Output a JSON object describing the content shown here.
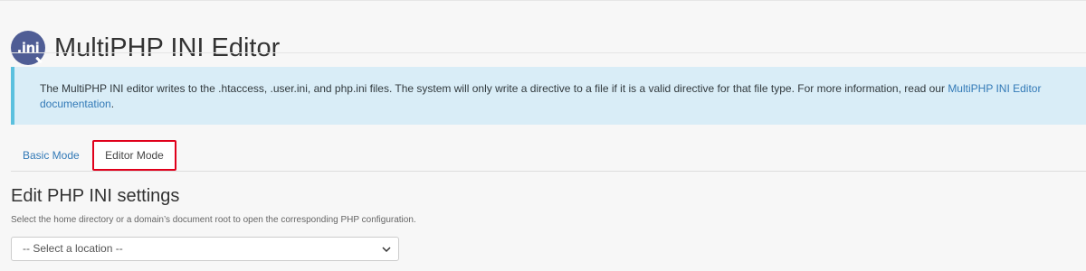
{
  "header": {
    "logo_text": ".ini",
    "title": "MultiPHP INI Editor"
  },
  "alert": {
    "text": "The MultiPHP INI editor writes to the .htaccess, .user.ini, and php.ini files. The system will only write a directive to a file if it is a valid directive for that file type. For more information, read our ",
    "link_text": "MultiPHP INI Editor documentation",
    "suffix": "."
  },
  "tabs": [
    {
      "label": "Basic Mode",
      "active": false
    },
    {
      "label": "Editor Mode",
      "active": true,
      "highlighted": true
    }
  ],
  "section": {
    "title": "Edit PHP INI settings",
    "help": "Select the home directory or a domain’s document root to open the corresponding PHP configuration."
  },
  "location_select": {
    "selected": "-- Select a location --"
  },
  "colors": {
    "logo": "#4f5d95",
    "alert_background": "#d9edf7",
    "alert_border": "#5bc0de",
    "link": "#337ab7",
    "highlight": "#e0001b"
  },
  "icons": {
    "logo": "ini-file-icon",
    "select": "chevron-down-icon"
  }
}
